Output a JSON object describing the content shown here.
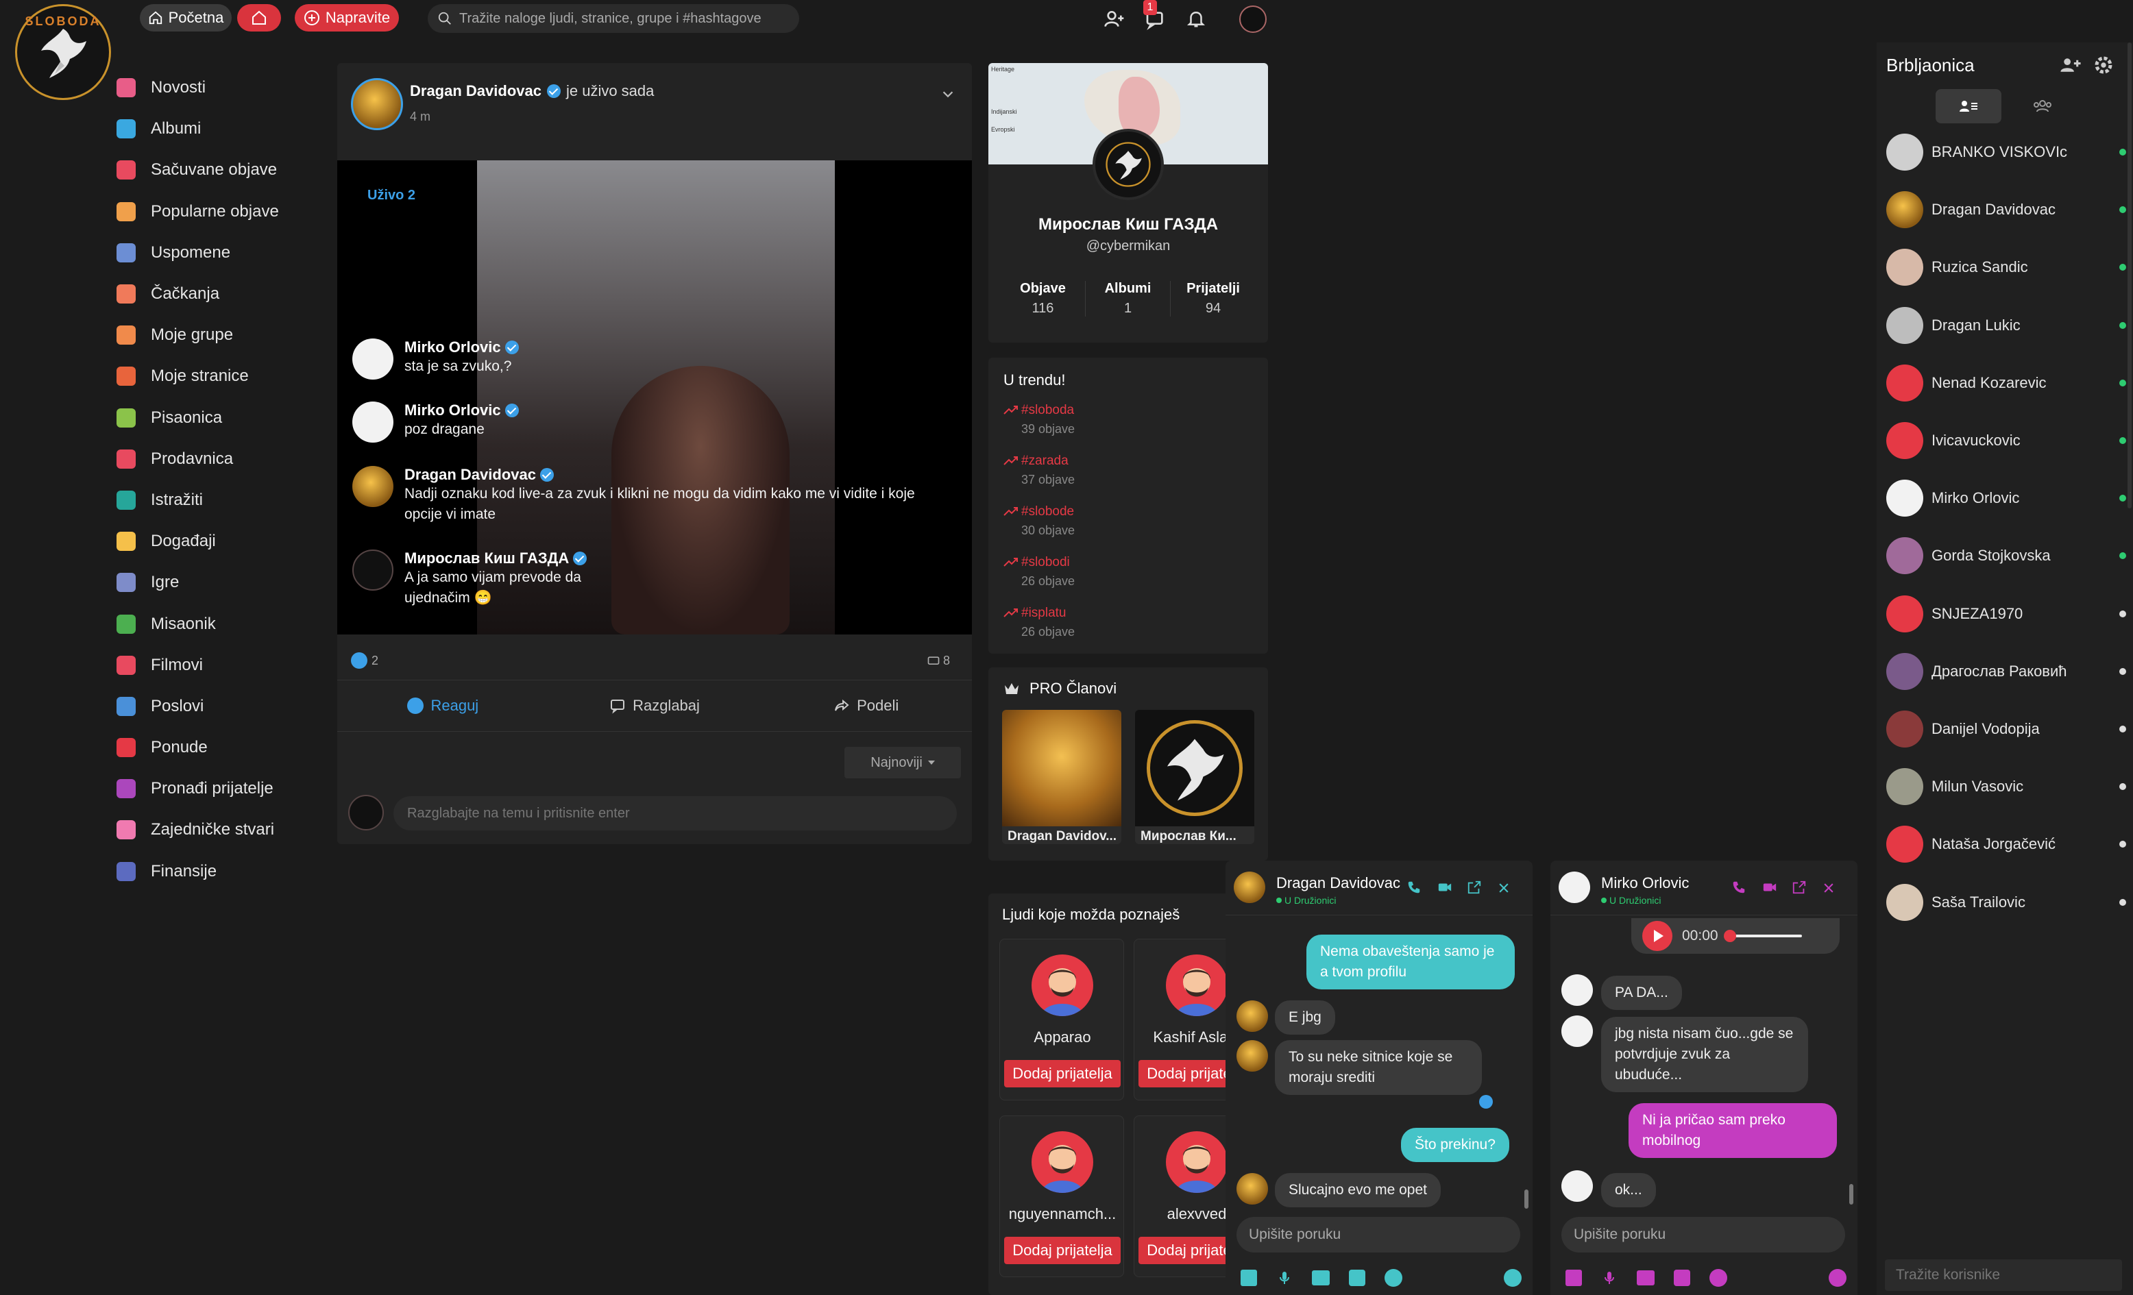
{
  "topbar": {
    "home_label": "Početna",
    "create_label": "Napravite",
    "search_placeholder": "Tražite naloge ljudi, stranice, grupe i #hashtagove",
    "messages_badge": "1",
    "logo_text": "SLOBODA"
  },
  "nav": {
    "items": [
      {
        "label": "Novosti",
        "icon": "home-icon",
        "color": "#e85d88"
      },
      {
        "label": "Albumi",
        "icon": "album-icon",
        "color": "#3aa8e0"
      },
      {
        "label": "Sačuvane objave",
        "icon": "bookmark-icon",
        "color": "#e84a5f"
      },
      {
        "label": "Popularne objave",
        "icon": "popular-icon",
        "color": "#f0a04b"
      },
      {
        "label": "Uspomene",
        "icon": "memories-icon",
        "color": "#6c8ed4"
      },
      {
        "label": "Čačkanja",
        "icon": "poke-icon",
        "color": "#f07a5a"
      },
      {
        "label": "Moje grupe",
        "icon": "groups-icon",
        "color": "#f08a4b"
      },
      {
        "label": "Moje stranice",
        "icon": "pages-icon",
        "color": "#e8643c"
      },
      {
        "label": "Pisaonica",
        "icon": "blog-icon",
        "color": "#8bc34a"
      },
      {
        "label": "Prodavnica",
        "icon": "market-icon",
        "color": "#e84a5f"
      },
      {
        "label": "Istražiti",
        "icon": "explore-icon",
        "color": "#26a69a"
      },
      {
        "label": "Događaji",
        "icon": "events-icon",
        "color": "#f5c04a"
      },
      {
        "label": "Igre",
        "icon": "games-icon",
        "color": "#7e8cc9"
      },
      {
        "label": "Misaonik",
        "icon": "forum-icon",
        "color": "#4caf50"
      },
      {
        "label": "Filmovi",
        "icon": "movies-icon",
        "color": "#e84a5f"
      },
      {
        "label": "Poslovi",
        "icon": "jobs-icon",
        "color": "#4a90d9"
      },
      {
        "label": "Ponude",
        "icon": "offers-icon",
        "color": "#e53945"
      },
      {
        "label": "Pronađi prijatelje",
        "icon": "find-friends-icon",
        "color": "#ab47bc"
      },
      {
        "label": "Zajedničke stvari",
        "icon": "common-things-icon",
        "color": "#f07ab0"
      },
      {
        "label": "Finansije",
        "icon": "finance-icon",
        "color": "#5c6bc0"
      }
    ]
  },
  "post": {
    "author": "Dragan Davidovac",
    "status": "je uživo sada",
    "time": "4 m",
    "live_badge": "Uživo 2",
    "reactions_count": "2",
    "comments_count": "8",
    "actions": {
      "react": "Reaguj",
      "comment": "Razglabaj",
      "share": "Podeli"
    },
    "sort_label": "Najnoviji",
    "comment_placeholder": "Razglabajte na temu i pritisnite enter",
    "live_comments": [
      {
        "name": "Mirko Orlovic",
        "text": "sta je sa zvuko,?"
      },
      {
        "name": "Mirko Orlovic",
        "text": "poz dragane"
      },
      {
        "name": "Dragan Davidovac",
        "text": "Nadji oznaku kod live-a za zvuk i klikni ne mogu da vidim kako me vi vidite i koje opcije vi imate"
      },
      {
        "name": "Мирослав Киш ГАЗДА",
        "text": "A ja samo vijam prevode da ujednačim 😁"
      }
    ]
  },
  "profile": {
    "name": "Мирослав Киш ГАЗДА",
    "handle": "@cybermikan",
    "map_labels": [
      "Heritage",
      "Indijanski",
      "Evropski"
    ],
    "stats": [
      {
        "label": "Objave",
        "value": "116"
      },
      {
        "label": "Albumi",
        "value": "1"
      },
      {
        "label": "Prijatelji",
        "value": "94"
      }
    ]
  },
  "trending": {
    "title": "U trendu!",
    "items": [
      {
        "tag": "#sloboda",
        "count": "39 objave"
      },
      {
        "tag": "#zarada",
        "count": "37 objave"
      },
      {
        "tag": "#slobode",
        "count": "30 objave"
      },
      {
        "tag": "#slobodi",
        "count": "26 objave"
      },
      {
        "tag": "#isplatu",
        "count": "26 objave"
      }
    ]
  },
  "pro": {
    "title": "PRO Članovi",
    "members": [
      {
        "name": "Dragan Davidov..."
      },
      {
        "name": "Мирослав Ки..."
      }
    ]
  },
  "people": {
    "title": "Ljudi koje možda poznaješ",
    "add_label": "Dodaj prijatelja",
    "items": [
      {
        "name": "Apparao"
      },
      {
        "name": "Kashif Aslam"
      },
      {
        "name": "nguyennamch..."
      },
      {
        "name": "alexvved"
      }
    ]
  },
  "chat_list": {
    "title": "Brbljaonica",
    "search_placeholder": "Tražite korisnike",
    "contacts": [
      {
        "name": "BRANKO VISKOVIc",
        "online": true
      },
      {
        "name": "Dragan Davidovac",
        "online": true
      },
      {
        "name": "Ruzica Sandic",
        "online": true
      },
      {
        "name": "Dragan Lukic",
        "online": true
      },
      {
        "name": "Nenad Kozarevic",
        "online": true
      },
      {
        "name": "Ivicavuckovic",
        "online": true
      },
      {
        "name": "Mirko Orlovic",
        "online": true
      },
      {
        "name": "Gorda Stojkovska",
        "online": true
      },
      {
        "name": "SNJEZA1970",
        "online": false
      },
      {
        "name": "Драгослав Раковић",
        "online": false
      },
      {
        "name": "Danijel Vodopija",
        "online": false
      },
      {
        "name": "Milun Vasovic",
        "online": false
      },
      {
        "name": "Nataša Jorgačević",
        "online": false
      },
      {
        "name": "Saša Trailovic",
        "online": false
      }
    ]
  },
  "chat1": {
    "name": "Dragan Davidovac",
    "status": "U Družionici",
    "accent": "#45c4c8",
    "input_placeholder": "Upišite poruku",
    "messages": [
      {
        "text": "Nema obaveštenja samo je a tvom profilu",
        "from": "me"
      },
      {
        "text": "E jbg",
        "from": "them"
      },
      {
        "text": "To su neke sitnice koje se moraju srediti",
        "from": "them"
      },
      {
        "text": "Što prekinu?",
        "from": "me"
      },
      {
        "text": "Slucajno evo me opet",
        "from": "them"
      }
    ]
  },
  "chat2": {
    "name": "Mirko Orlovic",
    "status": "U Družionici",
    "accent": "#c43cc0",
    "input_placeholder": "Upišite poruku",
    "audio_time": "00:00",
    "messages": [
      {
        "text": "PA DA...",
        "from": "them"
      },
      {
        "text": "jbg nista nisam čuo...gde se potvrdjuje zvuk za ubuduće...",
        "from": "them"
      },
      {
        "text": "Ni ja pričao sam preko mobilnog",
        "from": "me"
      },
      {
        "text": "ok...",
        "from": "them"
      }
    ]
  }
}
